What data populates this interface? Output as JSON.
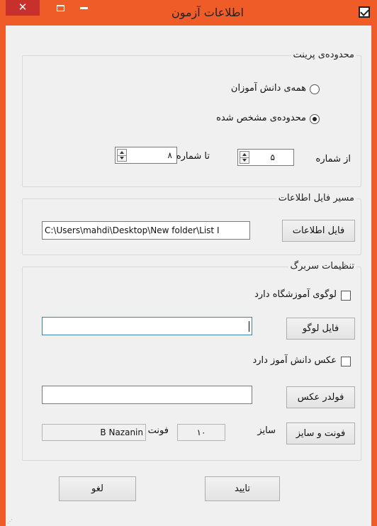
{
  "window": {
    "title": "اطلاعات آزمون",
    "close_glyph": "✕"
  },
  "print_range": {
    "legend": "محدوده‌ی پرینت",
    "all_students_label": "همه‌ی دانش آموزان",
    "specified_range_label": "محدوده‌ی مشخص شده",
    "selected": "specified_range",
    "from_label": "از شماره",
    "from_value": "۵",
    "to_label": "تا شماره",
    "to_value": "۸"
  },
  "data_file": {
    "legend": "مسیر فایل اطلاعات",
    "button_label": "فایل اطلاعات",
    "path_value": "C:\\Users\\mahdi\\Desktop\\New folder\\List I"
  },
  "header_settings": {
    "legend": "تنظیمات سربرگ",
    "has_logo_label": "لوگوی آموزشگاه دارد",
    "has_logo_checked": false,
    "logo_button_label": "فایل لوگو",
    "logo_path_value": "",
    "has_photo_label": "عکس دانش آموز دارد",
    "has_photo_checked": false,
    "photo_button_label": "فولدر عکس",
    "photo_path_value": "",
    "font_button_label": "فونت و سایز",
    "size_label": "سایز",
    "size_value": "۱۰",
    "font_label": "فونت",
    "font_value": "B Nazanin"
  },
  "actions": {
    "ok_label": "تایید",
    "cancel_label": "لغو"
  }
}
